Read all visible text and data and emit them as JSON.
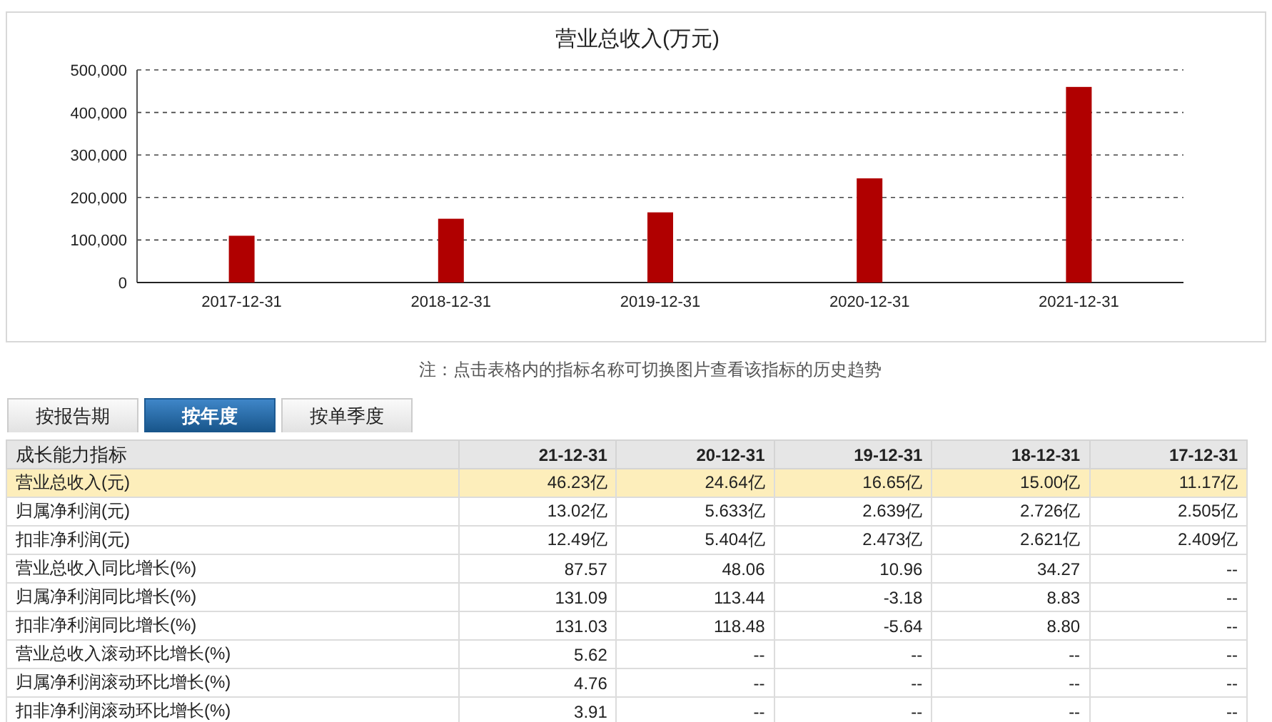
{
  "chart": {
    "chart_data": {
      "type": "bar",
      "title": "营业总收入(万元)",
      "categories": [
        "2017-12-31",
        "2018-12-31",
        "2019-12-31",
        "2020-12-31",
        "2021-12-31"
      ],
      "grid": true,
      "series": [
        {
          "color": "#b00000",
          "values": [
            110000,
            150000,
            165000,
            245000,
            460000
          ]
        }
      ],
      "ylim": [
        0,
        500000
      ],
      "yticks": [
        {
          "value": 0,
          "label": "0"
        },
        {
          "value": 100000,
          "label": "100,000"
        },
        {
          "value": 200000,
          "label": "200,000"
        },
        {
          "value": 300000,
          "label": "300,000"
        },
        {
          "value": 400000,
          "label": "400,000"
        },
        {
          "value": 500000,
          "label": "500,000"
        }
      ]
    }
  },
  "note": "注：点击表格内的指标名称可切换图片查看该指标的历史趋势",
  "tabs": [
    {
      "label": "按报告期",
      "selected": false
    },
    {
      "label": "按年度",
      "selected": true
    },
    {
      "label": "按单季度",
      "selected": false
    }
  ],
  "table": {
    "columns": [
      "成长能力指标",
      "21-12-31",
      "20-12-31",
      "19-12-31",
      "18-12-31",
      "17-12-31"
    ],
    "rows": [
      {
        "selected": true,
        "cells": [
          "营业总收入(元)",
          "46.23亿",
          "24.64亿",
          "16.65亿",
          "15.00亿",
          "11.17亿"
        ]
      },
      {
        "selected": false,
        "cells": [
          "归属净利润(元)",
          "13.02亿",
          "5.633亿",
          "2.639亿",
          "2.726亿",
          "2.505亿"
        ]
      },
      {
        "selected": false,
        "cells": [
          "扣非净利润(元)",
          "12.49亿",
          "5.404亿",
          "2.473亿",
          "2.621亿",
          "2.409亿"
        ]
      },
      {
        "selected": false,
        "cells": [
          "营业总收入同比增长(%)",
          "87.57",
          "48.06",
          "10.96",
          "34.27",
          "--"
        ]
      },
      {
        "selected": false,
        "cells": [
          "归属净利润同比增长(%)",
          "131.09",
          "113.44",
          "-3.18",
          "8.83",
          "--"
        ]
      },
      {
        "selected": false,
        "cells": [
          "扣非净利润同比增长(%)",
          "131.03",
          "118.48",
          "-5.64",
          "8.80",
          "--"
        ]
      },
      {
        "selected": false,
        "cells": [
          "营业总收入滚动环比增长(%)",
          "5.62",
          "--",
          "--",
          "--",
          "--"
        ]
      },
      {
        "selected": false,
        "cells": [
          "归属净利润滚动环比增长(%)",
          "4.76",
          "--",
          "--",
          "--",
          "--"
        ]
      },
      {
        "selected": false,
        "cells": [
          "扣非净利润滚动环比增长(%)",
          "3.91",
          "--",
          "--",
          "--",
          "--"
        ]
      }
    ]
  }
}
